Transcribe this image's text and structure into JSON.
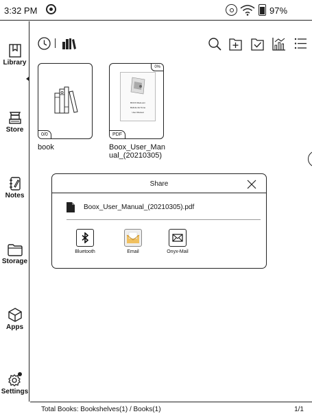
{
  "status_bar": {
    "time": "3:32 PM",
    "battery": "97%"
  },
  "sidebar": {
    "items": [
      {
        "label": "Library",
        "icon": "library-icon"
      },
      {
        "label": "Store",
        "icon": "store-icon"
      },
      {
        "label": "Notes",
        "icon": "notes-icon"
      },
      {
        "label": "Storage",
        "icon": "storage-icon"
      },
      {
        "label": "Apps",
        "icon": "apps-icon"
      },
      {
        "label": "Settings",
        "icon": "settings-icon"
      }
    ]
  },
  "toolbar": {
    "left_icons": [
      "recent-icon",
      "bookshelf-icon"
    ],
    "right_icons": [
      "search-icon",
      "add-folder-icon",
      "select-icon",
      "statistics-icon",
      "list-view-icon"
    ]
  },
  "books": [
    {
      "title": "book",
      "badge": "0/0",
      "type": "shelf"
    },
    {
      "title": "Boox_User_Manual_(20210305)",
      "title_line1": "Boox_User_Man",
      "title_line2": "ual_(20210305)",
      "badge": "PDF",
      "progress": "0%",
      "cover_title": "BOOX MaxLumi",
      "cover_subtitle": "Multi-E-ink Tome",
      "cover_line": "User Manual",
      "type": "pdf"
    }
  ],
  "share_dialog": {
    "title": "Share",
    "file_name": "Boox_User_Manual_(20210305).pdf",
    "options": [
      {
        "label": "Bluetooth",
        "icon": "bluetooth-icon"
      },
      {
        "label": "Email",
        "icon": "email-icon"
      },
      {
        "label": "Onyx-Mail",
        "icon": "onyx-mail-icon"
      }
    ]
  },
  "footer": {
    "total": "Total Books: Bookshelves(1) / Books(1)",
    "page": "1/1"
  }
}
